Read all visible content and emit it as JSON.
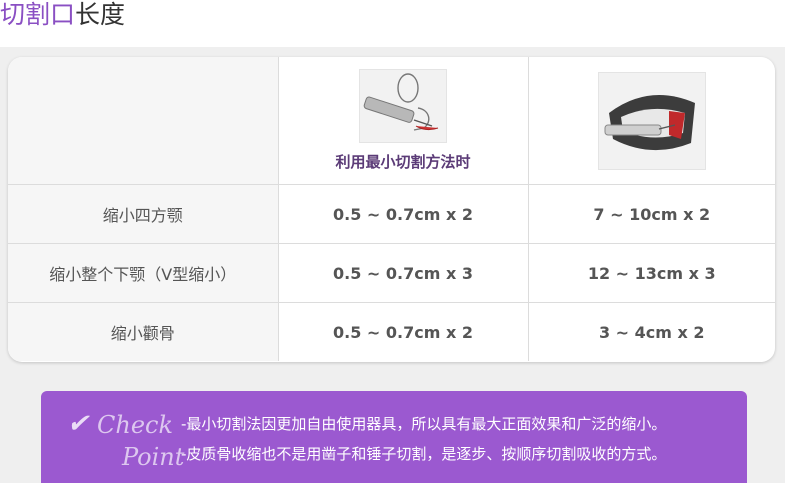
{
  "title": {
    "accent": "切割口",
    "rest": "长度"
  },
  "table": {
    "header": {
      "col2_label": "利用最小切割方法时"
    },
    "rows": [
      {
        "label": "缩小四方颚",
        "col2": "0.5 ~ 0.7cm x 2",
        "col3": "7 ~ 10cm x 2"
      },
      {
        "label": "缩小整个下颚（V型缩小）",
        "col2": "0.5 ~ 0.7cm x 3",
        "col3": "12 ~ 13cm x 3"
      },
      {
        "label": "缩小颧骨",
        "col2": "0.5 ~ 0.7cm x 2",
        "col3": "3 ~ 4cm x 2"
      }
    ]
  },
  "check_point": {
    "check_word": "Check",
    "point_word": "Point",
    "lines": [
      "-最小切割法因更加自由使用器具，所以具有最大正面效果和广泛的缩小。",
      "-皮质骨收缩也不是用凿子和锤子切割，是逐步、按顺序切割吸收的方式。"
    ]
  },
  "colors": {
    "accent": "#8a4fc3",
    "check_bg": "#9b59d0",
    "panel_bg": "#efefef"
  }
}
